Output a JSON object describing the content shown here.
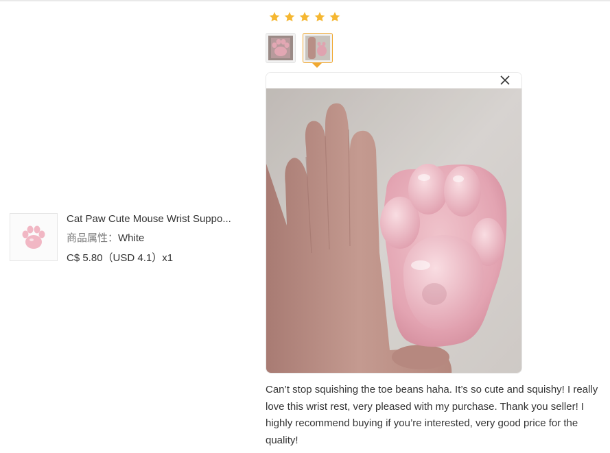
{
  "product": {
    "title": "Cat Paw Cute Mouse Wrist Suppo...",
    "attr_label": "商品属性：",
    "attr_value": "White",
    "price": "C$ 5.80（USD  4.1）x1"
  },
  "review": {
    "rating": 5,
    "text": "Can’t stop squishing the toe beans haha. It’s so cute and squishy! I really love this wrist rest, very pleased with my purchase. Thank you seller! I highly recommend buying if you’re interested, very good price for the quality!"
  },
  "colors": {
    "star": "#f5b732",
    "active_thumb_border": "#f0a830",
    "paw_pink": "#e8a6b4"
  },
  "icons": {
    "star": "star-icon",
    "close": "close-icon"
  }
}
